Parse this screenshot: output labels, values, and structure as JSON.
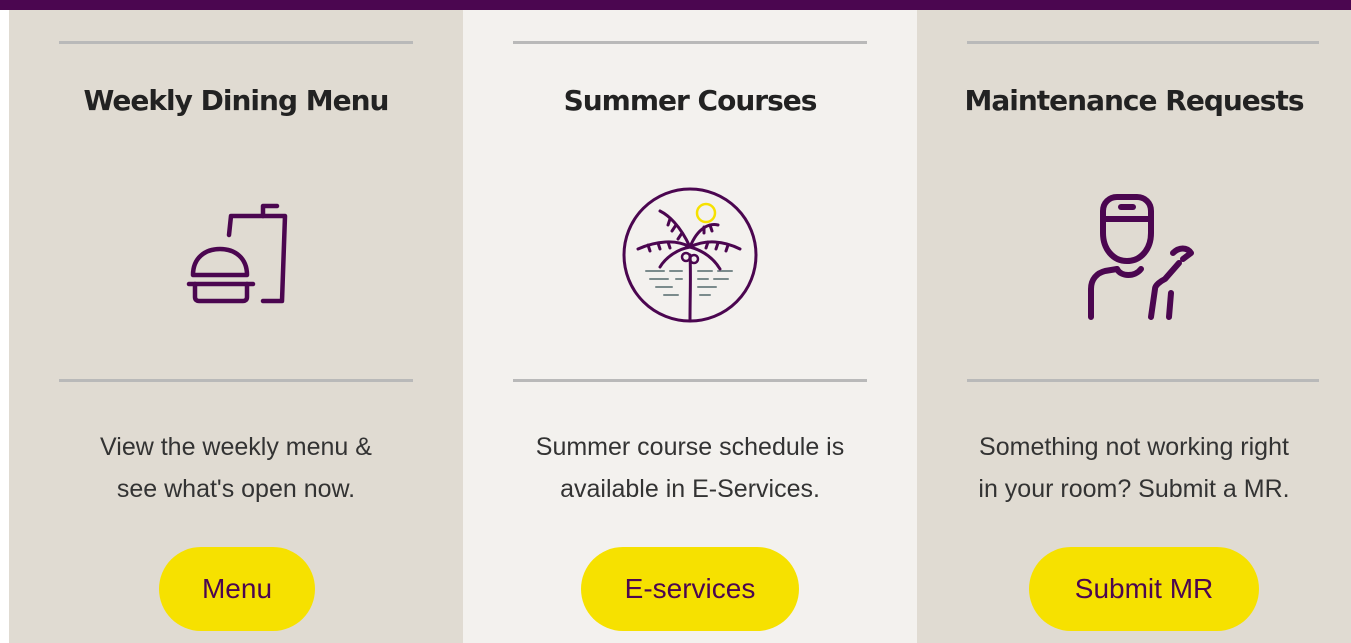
{
  "colors": {
    "brand_purple": "#4b0650",
    "button_yellow": "#f6e100",
    "card_beige": "#e0dbd2",
    "card_light": "#f3f1ee"
  },
  "cards": [
    {
      "title": "Weekly Dining Menu",
      "icon": "burger-drink-icon",
      "description_line1": "View the weekly menu &",
      "description_line2": "see what's open now.",
      "button_label": "Menu"
    },
    {
      "title": "Summer Courses",
      "icon": "palm-tree-icon",
      "description_line1": "Summer course schedule is",
      "description_line2": "available in E-Services.",
      "button_label": "E-services"
    },
    {
      "title": "Maintenance Requests",
      "icon": "repair-worker-icon",
      "description_line1": "Something not working right",
      "description_line2": "in your room? Submit a MR.",
      "button_label": "Submit MR"
    }
  ]
}
